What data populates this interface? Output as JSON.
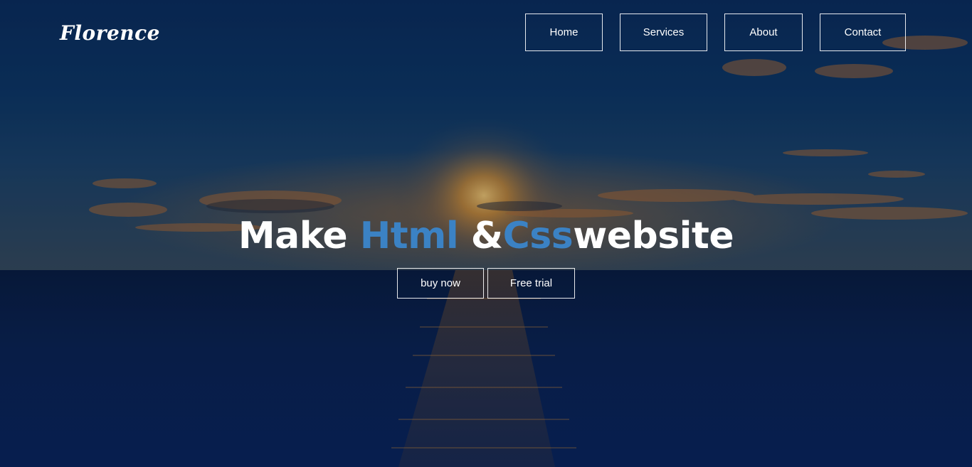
{
  "brand": {
    "logo_text": "Florence"
  },
  "nav": {
    "items": [
      {
        "label": "Home"
      },
      {
        "label": "Services"
      },
      {
        "label": "About"
      },
      {
        "label": "Contact"
      }
    ]
  },
  "hero": {
    "headline_part1": "Make ",
    "headline_accent1": "Html",
    "headline_part2": " &",
    "headline_accent2": "Css",
    "headline_part3": "website",
    "accent_color": "#3b82c4",
    "buttons": [
      {
        "label": "buy now"
      },
      {
        "label": "Free trial"
      }
    ]
  }
}
